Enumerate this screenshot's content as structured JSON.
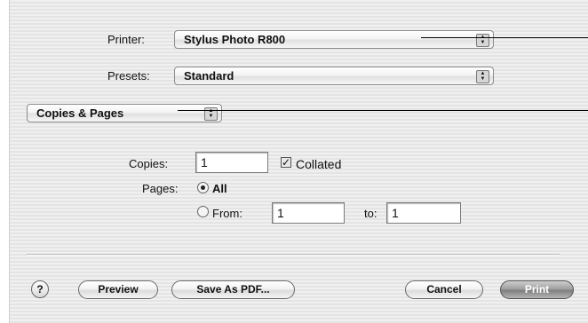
{
  "printer": {
    "label": "Printer:",
    "value": "Stylus Photo R800"
  },
  "presets": {
    "label": "Presets:",
    "value": "Standard"
  },
  "panel": {
    "value": "Copies & Pages"
  },
  "copies": {
    "label": "Copies:",
    "value": "1",
    "collated_label": "Collated",
    "collated_checked": true
  },
  "pages": {
    "label": "Pages:",
    "all_label": "All",
    "from_label": "From:",
    "from_value": "1",
    "to_label": "to:",
    "to_value": "1",
    "selected": "All"
  },
  "buttons": {
    "help": "?",
    "preview": "Preview",
    "save_pdf": "Save As PDF...",
    "cancel": "Cancel",
    "print": "Print"
  },
  "icons": {
    "popup_arrows": "up-down-arrows-icon",
    "check": "checkmark-icon"
  }
}
